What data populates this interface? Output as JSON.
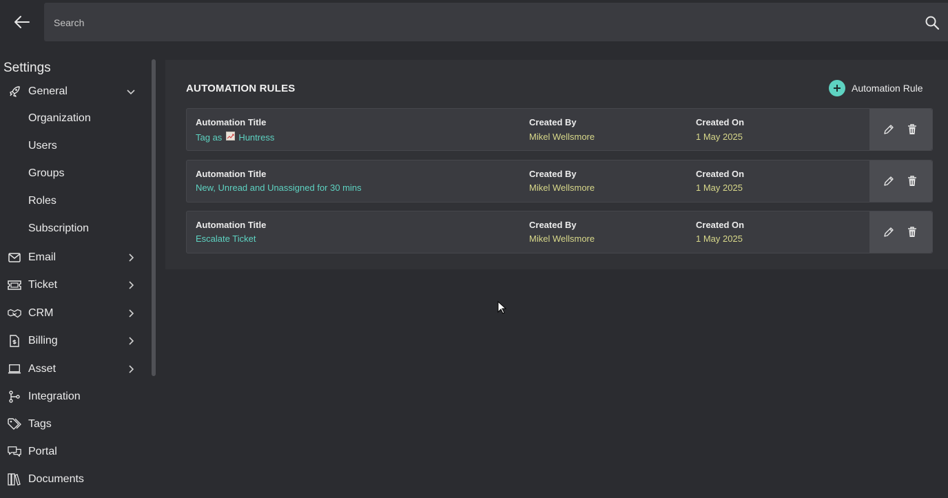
{
  "header": {
    "back_icon": "arrow-left-icon",
    "search_placeholder": "Search",
    "search_icon": "search-icon"
  },
  "sidebar": {
    "title": "Settings",
    "general": {
      "label": "General",
      "icon": "rocket-icon",
      "expanded": true,
      "children": [
        "Organization",
        "Users",
        "Groups",
        "Roles",
        "Subscription"
      ]
    },
    "items": [
      {
        "label": "Email",
        "icon": "envelope-icon",
        "has_children": true
      },
      {
        "label": "Ticket",
        "icon": "ticket-icon",
        "has_children": true
      },
      {
        "label": "CRM",
        "icon": "handshake-icon",
        "has_children": true
      },
      {
        "label": "Billing",
        "icon": "invoice-icon",
        "has_children": true
      },
      {
        "label": "Asset",
        "icon": "laptop-icon",
        "has_children": true
      },
      {
        "label": "Integration",
        "icon": "git-branch-icon",
        "has_children": false
      },
      {
        "label": "Tags",
        "icon": "tags-icon",
        "has_children": false
      },
      {
        "label": "Portal",
        "icon": "chat-bubbles-icon",
        "has_children": false
      },
      {
        "label": "Documents",
        "icon": "books-icon",
        "has_children": false
      }
    ]
  },
  "main": {
    "title": "AUTOMATION RULES",
    "add_button_label": "Automation Rule",
    "columns": {
      "title": "Automation Title",
      "created_by": "Created By",
      "created_on": "Created On"
    },
    "rules": [
      {
        "title_prefix": "Tag as",
        "title_icon": "tag-emoji-icon",
        "title": "Huntress",
        "created_by": "Mikel Wellsmore",
        "created_on": "1 May 2025"
      },
      {
        "title_prefix": "",
        "title_icon": "",
        "title": "New, Unread and Unassigned for 30 mins",
        "created_by": "Mikel Wellsmore",
        "created_on": "1 May 2025"
      },
      {
        "title_prefix": "",
        "title_icon": "",
        "title": "Escalate Ticket",
        "created_by": "Mikel Wellsmore",
        "created_on": "1 May 2025"
      }
    ]
  },
  "colors": {
    "background": "#2b2c30",
    "panel": "#313236",
    "accent": "#5ed3c2",
    "meta_text": "#d8d88a"
  }
}
